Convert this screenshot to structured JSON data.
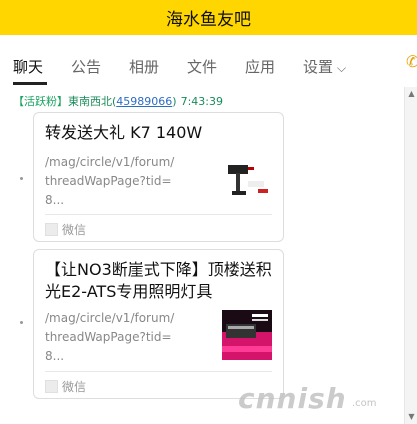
{
  "window": {
    "title": "海水鱼友吧"
  },
  "tabs": [
    {
      "label": "聊天",
      "active": true
    },
    {
      "label": "公告"
    },
    {
      "label": "相册"
    },
    {
      "label": "文件"
    },
    {
      "label": "应用"
    },
    {
      "label": "设置"
    }
  ],
  "message": {
    "tag": "【活跃粉】",
    "sender": "東南西北",
    "open_paren": "(",
    "sender_id": "45989066",
    "close_paren": ")",
    "time": "7:43:39"
  },
  "cards": [
    {
      "title": "转发送大礼 K7 140W",
      "url": "/mag/circle/v1/forum/threadWapPage?tid=8...",
      "source": "微信",
      "thumbnail": "led-light-photo-icon"
    },
    {
      "title": "【让NO3断崖式下降】顶楼送积光E2-ATS专用照明灯具",
      "url": "/mag/circle/v1/forum/threadWapPage?tid=8...",
      "source": "微信",
      "thumbnail": "light-promo-photo-icon"
    }
  ],
  "watermark": {
    "text": "cnnish",
    "small": ".com"
  },
  "colors": {
    "title_bar": "#ffd600",
    "tag_green": "#1aa260",
    "link_blue": "#2c6cc4"
  }
}
